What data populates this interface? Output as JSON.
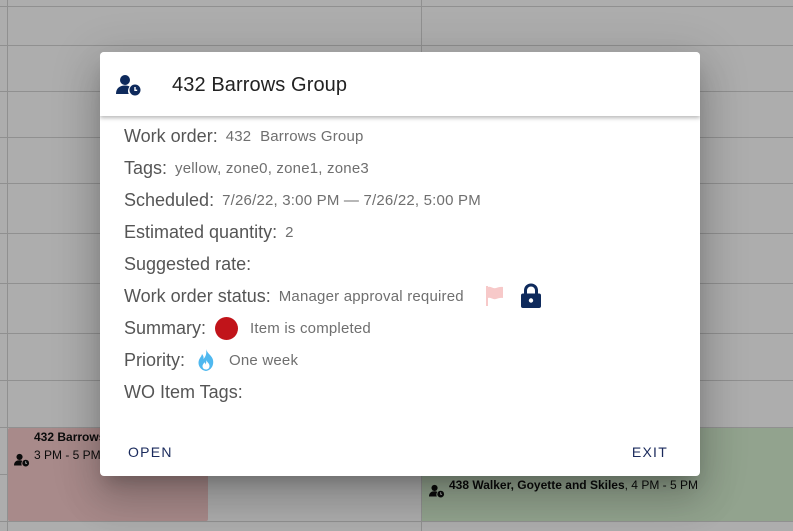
{
  "calendar": {
    "events": [
      {
        "title": "432 Barrows",
        "time": "3 PM - 5 PM",
        "icon": "user-clock-icon",
        "color": "#f8cccc"
      },
      {
        "title": "438 Walker, Goyette and Skiles",
        "time": ", 4 PM - 5 PM",
        "icon": "user-clock-icon",
        "color": "#d7f0d1"
      }
    ]
  },
  "dialog": {
    "title": "432 Barrows Group",
    "header_icon": "user-clock-icon",
    "fields": {
      "work_order": {
        "label": "Work order:",
        "value": "432  Barrows Group"
      },
      "tags": {
        "label": "Tags:",
        "value": "yellow, zone0, zone1, zone3"
      },
      "scheduled": {
        "label": "Scheduled:",
        "value": "7/26/22, 3:00 PM — 7/26/22, 5:00 PM"
      },
      "estimated_quantity": {
        "label": "Estimated quantity:",
        "value": "2"
      },
      "suggested_rate": {
        "label": "Suggested rate:",
        "value": ""
      },
      "work_order_status": {
        "label": "Work order status:",
        "value": "Manager approval required",
        "flag_color": "#f7c9c9",
        "lock_color": "#0e2a5c"
      },
      "summary": {
        "label": "Summary:",
        "value": "Item is completed",
        "dot_color": "#c1141a"
      },
      "priority": {
        "label": "Priority:",
        "value": "One week",
        "icon": "fire-icon",
        "icon_color": "#4fb8ef"
      },
      "wo_item_tags": {
        "label": "WO Item Tags:",
        "value": ""
      }
    },
    "actions": {
      "open_label": "OPEN",
      "exit_label": "EXIT"
    }
  },
  "colors": {
    "accent": "#1a2a5c",
    "scrim": "rgba(0,0,0,0.32)"
  }
}
